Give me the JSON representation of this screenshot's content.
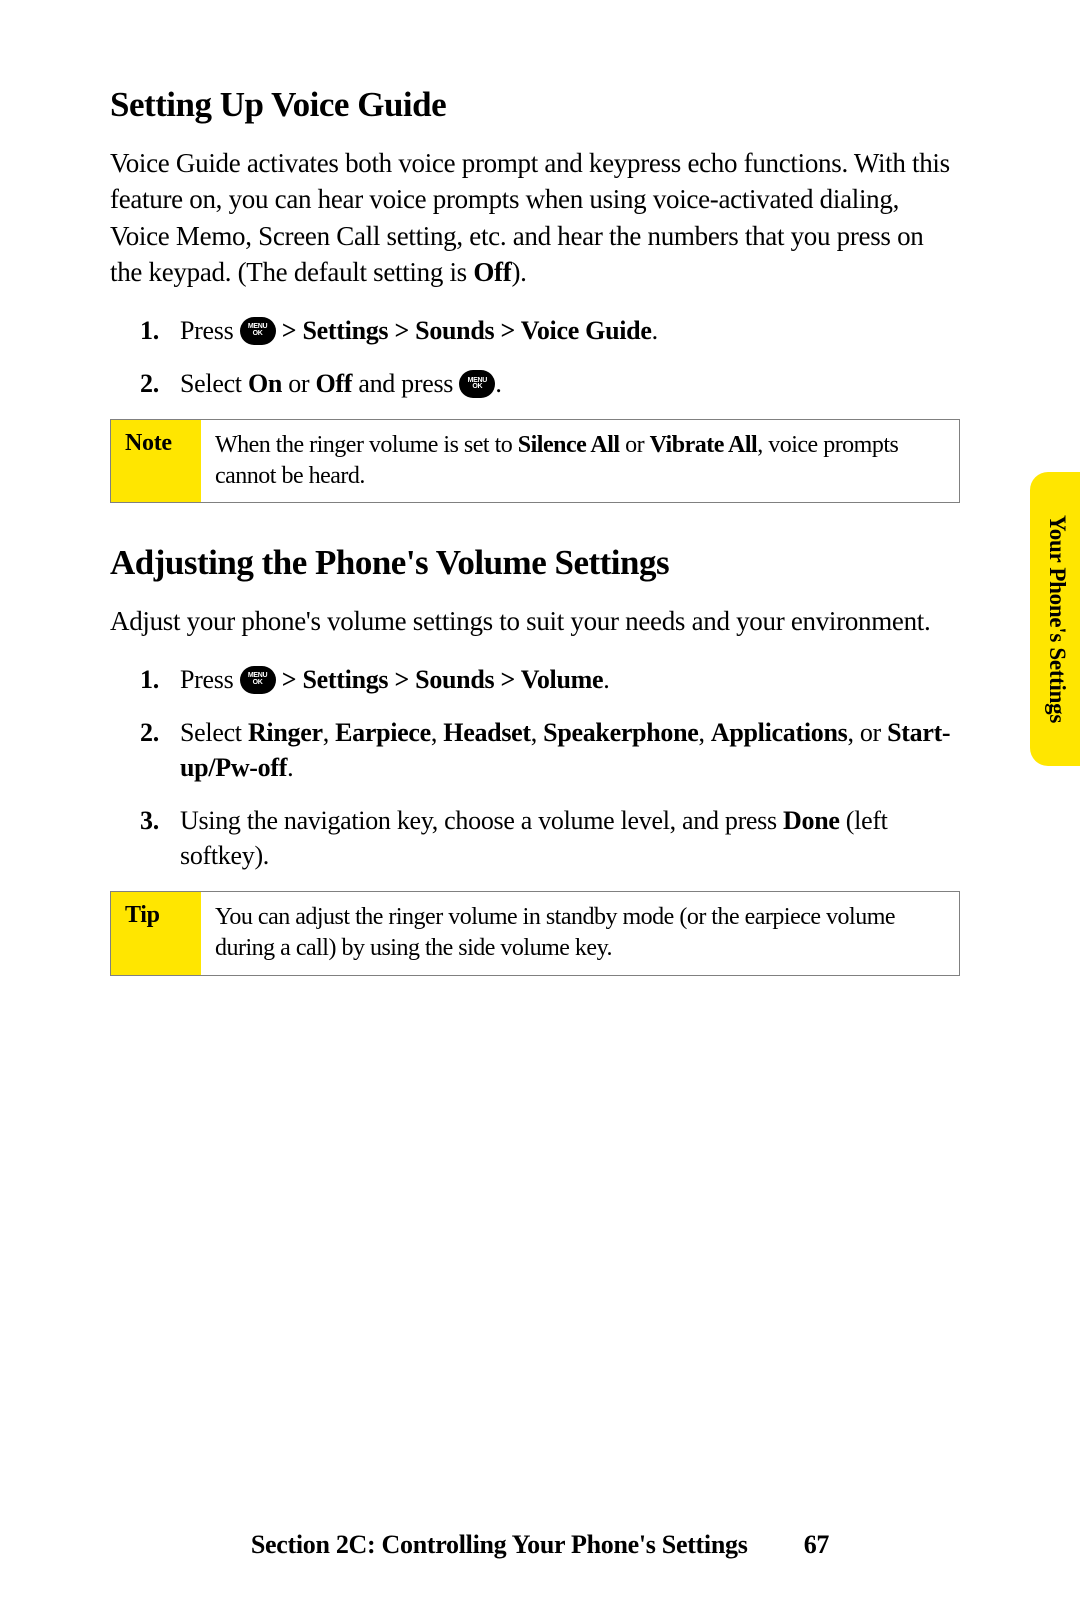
{
  "section1": {
    "heading": "Setting Up Voice Guide",
    "intro_parts": [
      "Voice Guide activates both voice prompt and keypress echo functions. With this feature on, you can hear voice prompts when using voice-activated dialing, Voice Memo, Screen Call setting, etc. and hear the numbers that you press on the keypad. (The default setting is ",
      "Off",
      ")."
    ],
    "steps": [
      {
        "prefix": "Press ",
        "icon": true,
        "bold1": " > Settings > Sounds > Voice Guide",
        "suffix": "."
      },
      {
        "prefix": "Select ",
        "bold1": "On",
        "mid1": " or ",
        "bold2": "Off",
        "mid2": " and press ",
        "icon2": true,
        "suffix": "."
      }
    ]
  },
  "note": {
    "label": "Note",
    "text1": "When the ringer volume is set to ",
    "bold1": "Silence All",
    "text2": " or ",
    "bold2": "Vibrate All",
    "text3": ", voice prompts cannot be heard."
  },
  "section2": {
    "heading": "Adjusting the Phone's Volume Settings",
    "intro": "Adjust your phone's volume settings to suit your needs and your environment.",
    "step1": {
      "prefix": "Press ",
      "bold": " > Settings > Sounds > Volume",
      "suffix": "."
    },
    "step2": {
      "prefix": "Select ",
      "b1": "Ringer",
      "c1": ", ",
      "b2": "Earpiece",
      "c2": ", ",
      "b3": "Headset",
      "c3": ", ",
      "b4": "Speakerphone",
      "c4": ", ",
      "b5": "Applications",
      "c5": ", or ",
      "b6": "Start-up/Pw-off",
      "suffix": "."
    },
    "step3": {
      "prefix": "Using the navigation key, choose a volume level, and press ",
      "bold": "Done",
      "suffix": " (left softkey)."
    }
  },
  "tip": {
    "label": "Tip",
    "text": "You can adjust the ringer volume in standby mode (or the earpiece volume during a call) by using the side volume key."
  },
  "sidetab": "Your Phone's Settings",
  "footer": {
    "section": "Section 2C: Controlling Your Phone's Settings",
    "page": "67"
  },
  "menu_icon": {
    "line1": "MENU",
    "line2": "OK"
  }
}
